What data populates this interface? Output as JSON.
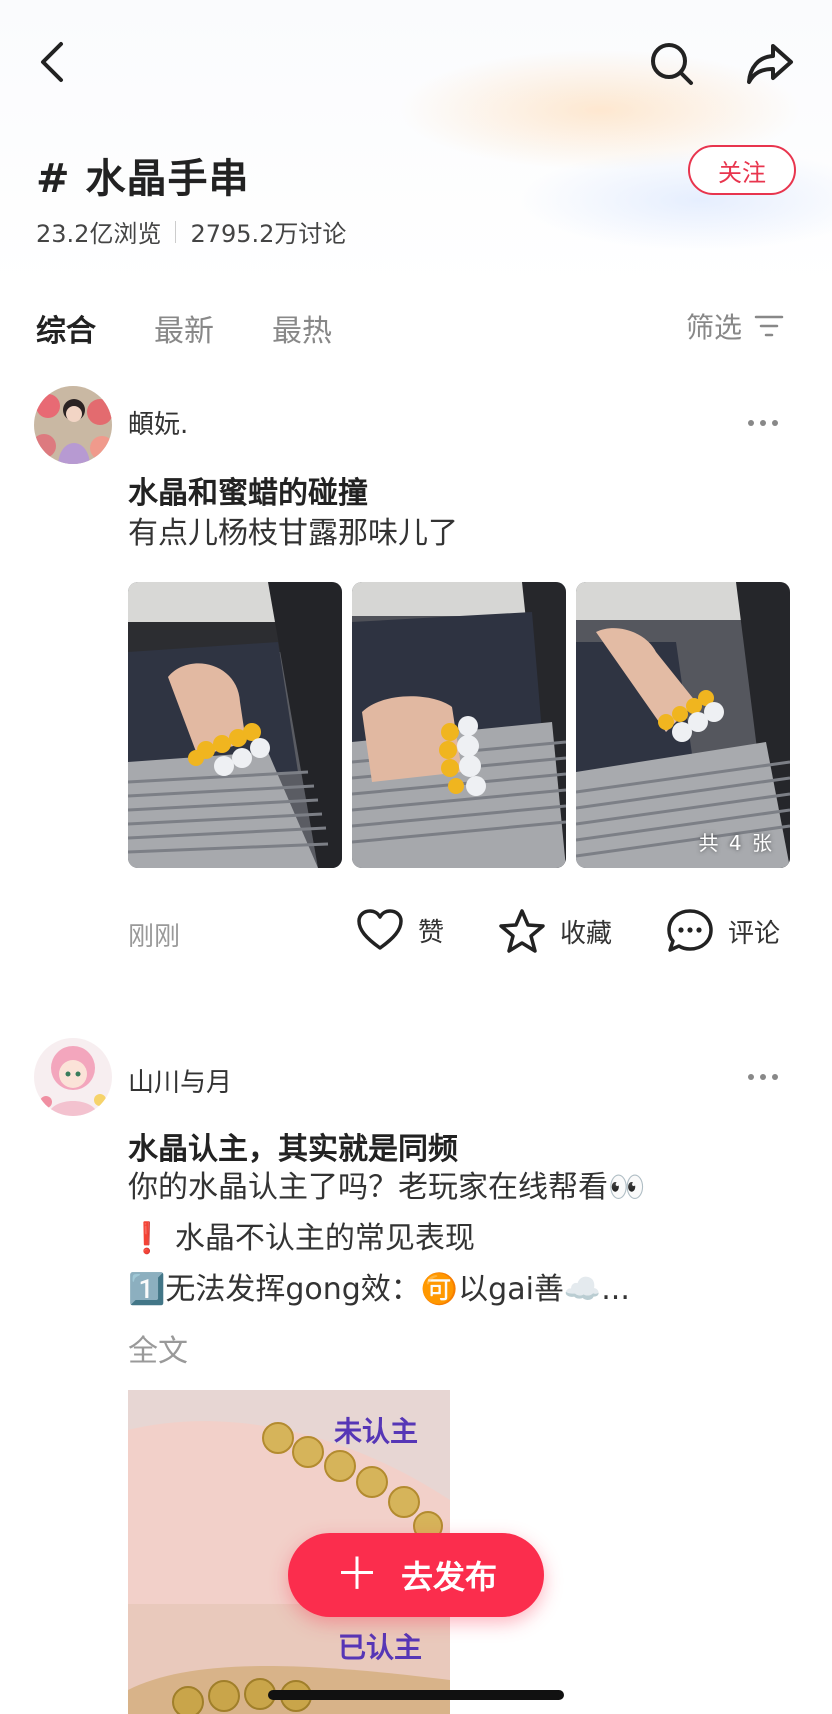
{
  "topic": {
    "title": "# 水晶手串",
    "views": "23.2亿浏览",
    "discussions": "2795.2万讨论",
    "follow_label": "关注"
  },
  "tabs": [
    {
      "label": "综合",
      "active": true
    },
    {
      "label": "最新",
      "active": false
    },
    {
      "label": "最热",
      "active": false
    }
  ],
  "filter_label": "筛选",
  "posts": [
    {
      "author": "頔妧.",
      "title": "水晶和蜜蜡的碰撞",
      "text": "有点儿杨枝甘露那味儿了",
      "photo_count_label": "共 4 张",
      "time": "刚刚",
      "like_label": "赞",
      "collect_label": "收藏",
      "comment_label": "评论"
    },
    {
      "author": "山川与月",
      "title": "水晶认主，其实就是同频",
      "lines": [
        "你的水晶认主了吗？老玩家在线帮看👀",
        "❗ 水晶不认主的常见表现",
        "1️⃣无法发挥gong效：🉑以gai善☁️..."
      ],
      "full_text_label": "全文",
      "image_labels": [
        "未认主",
        "已认主"
      ]
    }
  ],
  "publish_label": "去发布",
  "colors": {
    "accent": "#fb2d4d",
    "follow": "#e8354e",
    "label_purple": "#5636b6"
  }
}
